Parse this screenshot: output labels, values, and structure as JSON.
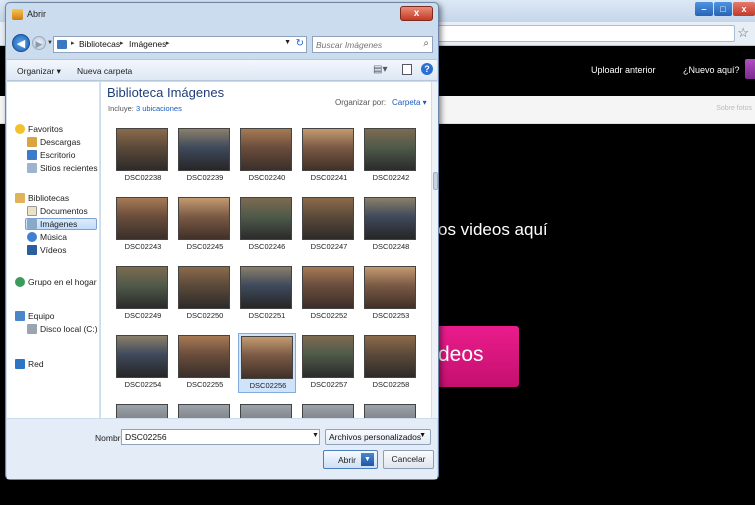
{
  "browser": {
    "nav_links": {
      "upload_prev": "Uploadr anterior",
      "new_here": "¿Nuevo aquí?"
    },
    "subbar_link": "Sobre fotos",
    "hero_text": "os videos aquí",
    "hero_button": "deos"
  },
  "dialog": {
    "title": "Abrir",
    "close_label": "x",
    "breadcrumb": [
      "Bibliotecas",
      "Imágenes"
    ],
    "search_placeholder": "Buscar Imágenes",
    "toolbar": {
      "organize": "Organizar ▾",
      "new_folder": "Nueva carpeta"
    },
    "nav": {
      "favorites_header": "Favoritos",
      "favorites": [
        "Descargas",
        "Escritorio",
        "Sitios recientes"
      ],
      "libraries_header": "Bibliotecas",
      "libraries": [
        "Documentos",
        "Imágenes",
        "Música",
        "Vídeos"
      ],
      "homegroup": "Grupo en el hogar",
      "computer_header": "Equipo",
      "computer": [
        "Disco local (C:)"
      ],
      "network": "Red",
      "selected": "Imágenes"
    },
    "content": {
      "title": "Biblioteca Imágenes",
      "includes_prefix": "Incluye:",
      "includes_link": "3 ubicaciones",
      "arrange_label": "Organizar por:",
      "arrange_value": "Carpeta ▾"
    },
    "thumbnails": [
      "DSC02238",
      "DSC02239",
      "DSC02240",
      "DSC02241",
      "DSC02242",
      "DSC02243",
      "DSC02245",
      "DSC02246",
      "DSC02247",
      "DSC02248",
      "DSC02249",
      "DSC02250",
      "DSC02251",
      "DSC02252",
      "DSC02253",
      "DSC02254",
      "DSC02255",
      "DSC02256",
      "DSC02257",
      "DSC02258"
    ],
    "selected_thumbnail": "DSC02256",
    "footer": {
      "filename_label": "Nombre:",
      "filename_value": "DSC02256",
      "filetype": "Archivos personalizados",
      "open": "Abrir",
      "cancel": "Cancelar"
    }
  },
  "colors": {
    "hero_button": "#d6137d",
    "dialog_frame": "#cbdcef",
    "library_title": "#1f3e78"
  }
}
